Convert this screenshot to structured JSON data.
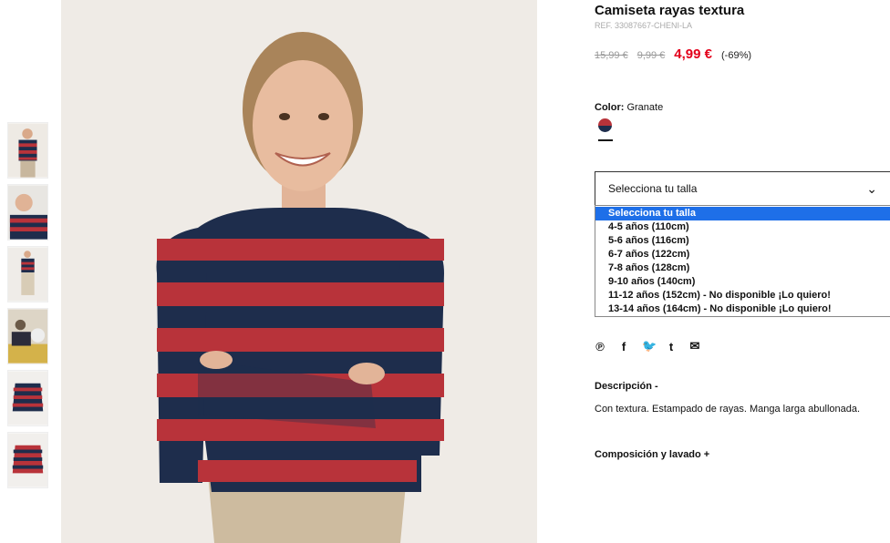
{
  "product": {
    "title": "Camiseta rayas textura",
    "ref": "REF. 33087667-CHENI-LA",
    "price_original": "15,99 €",
    "price_previous": "9,99 €",
    "price_current": "4,99 €",
    "discount": "(-69%)"
  },
  "color": {
    "label": "Color:",
    "value": "Granate",
    "swatch_colors": [
      "#b8333a",
      "#1e2d4c"
    ]
  },
  "size_select": {
    "selected": "Selecciona tu talla",
    "options": [
      "Selecciona tu talla",
      "4-5 años (110cm)",
      "5-6 años (116cm)",
      "6-7 años (122cm)",
      "7-8 años (128cm)",
      "9-10 años (140cm)",
      "11-12 años (152cm) - No disponible ¡Lo quiero!",
      "13-14 años (164cm) - No disponible ¡Lo quiero!"
    ]
  },
  "share": {
    "icons": [
      "pinterest-icon",
      "facebook-icon",
      "twitter-icon",
      "tumblr-icon",
      "email-icon"
    ],
    "glyphs": [
      "℗",
      "f",
      "🐦",
      "t",
      "✉"
    ]
  },
  "description": {
    "title": "Descripción -",
    "text": "Con textura. Estampado de rayas. Manga larga abullonada."
  },
  "composition": {
    "title": "Composición y lavado +"
  },
  "colors": {
    "price_red": "#e3001b",
    "select_highlight": "#1e6fe8",
    "stripe_red": "#b8333a",
    "stripe_blue": "#1e2d4c"
  }
}
